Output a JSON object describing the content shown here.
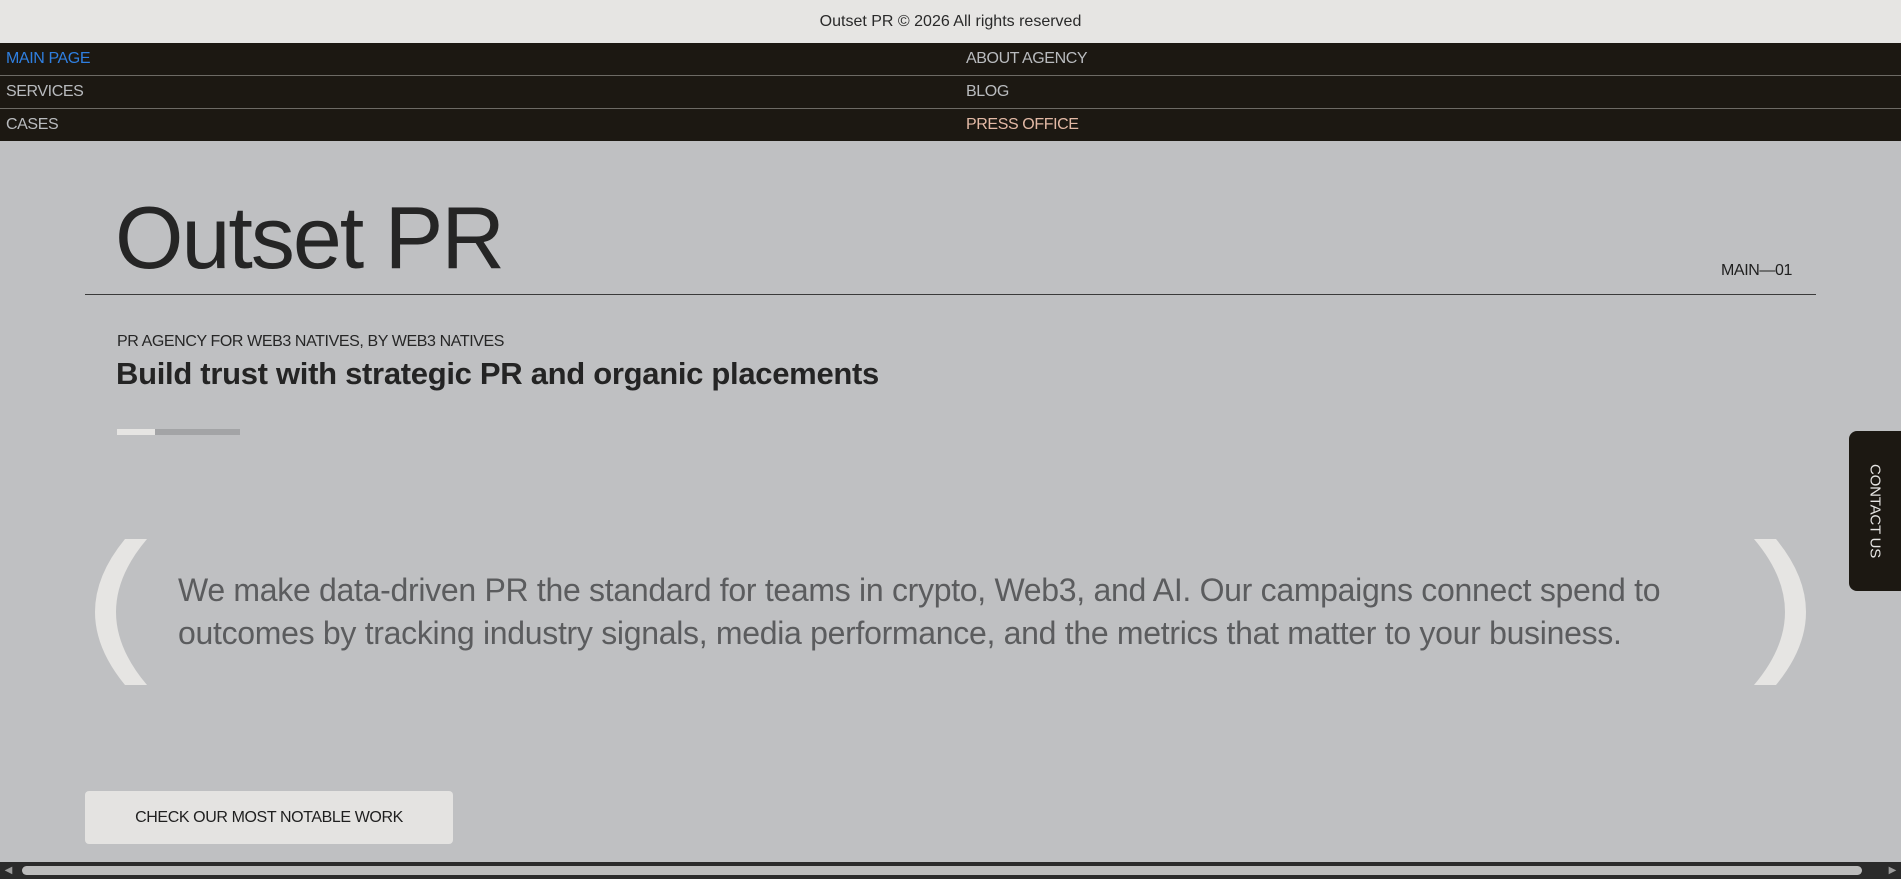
{
  "topbar": {
    "copyright": "Outset PR © 2026 All rights reserved"
  },
  "nav": {
    "main_page": "MAIN PAGE",
    "about_agency": "ABOUT AGENCY",
    "services": "SERVICES",
    "blog": "BLOG",
    "cases": "CASES",
    "press_office": "PRESS OFFICE"
  },
  "hero": {
    "title": "Outset PR",
    "section_code": "MAIN—01",
    "eyebrow": "PR AGENCY FOR WEB3 NATIVES, BY WEB3 NATIVES",
    "headline": "Build trust with strategic PR and organic placements",
    "slide_progress": 0.31
  },
  "quote": {
    "text": "We make data-driven PR the standard for teams in crypto, Web3, and AI. Our campaigns connect spend to outcomes by tracking industry signals, media performance, and the metrics that matter to your business."
  },
  "cta": {
    "label": "CHECK OUR MOST NOTABLE WORK"
  },
  "contact": {
    "label": "CONTACT US"
  },
  "icons": {
    "left_bracket": "left-bracket-icon",
    "right_bracket": "right-bracket-icon",
    "scroll_left": "chevron-left-icon",
    "scroll_right": "chevron-right-icon"
  },
  "colors": {
    "page_bg": "#bfc0c2",
    "nav_bg": "#1c1812",
    "active_link": "#2f7fe0",
    "press_link": "#e3b9a5",
    "bracket": "#e6e5e3"
  }
}
